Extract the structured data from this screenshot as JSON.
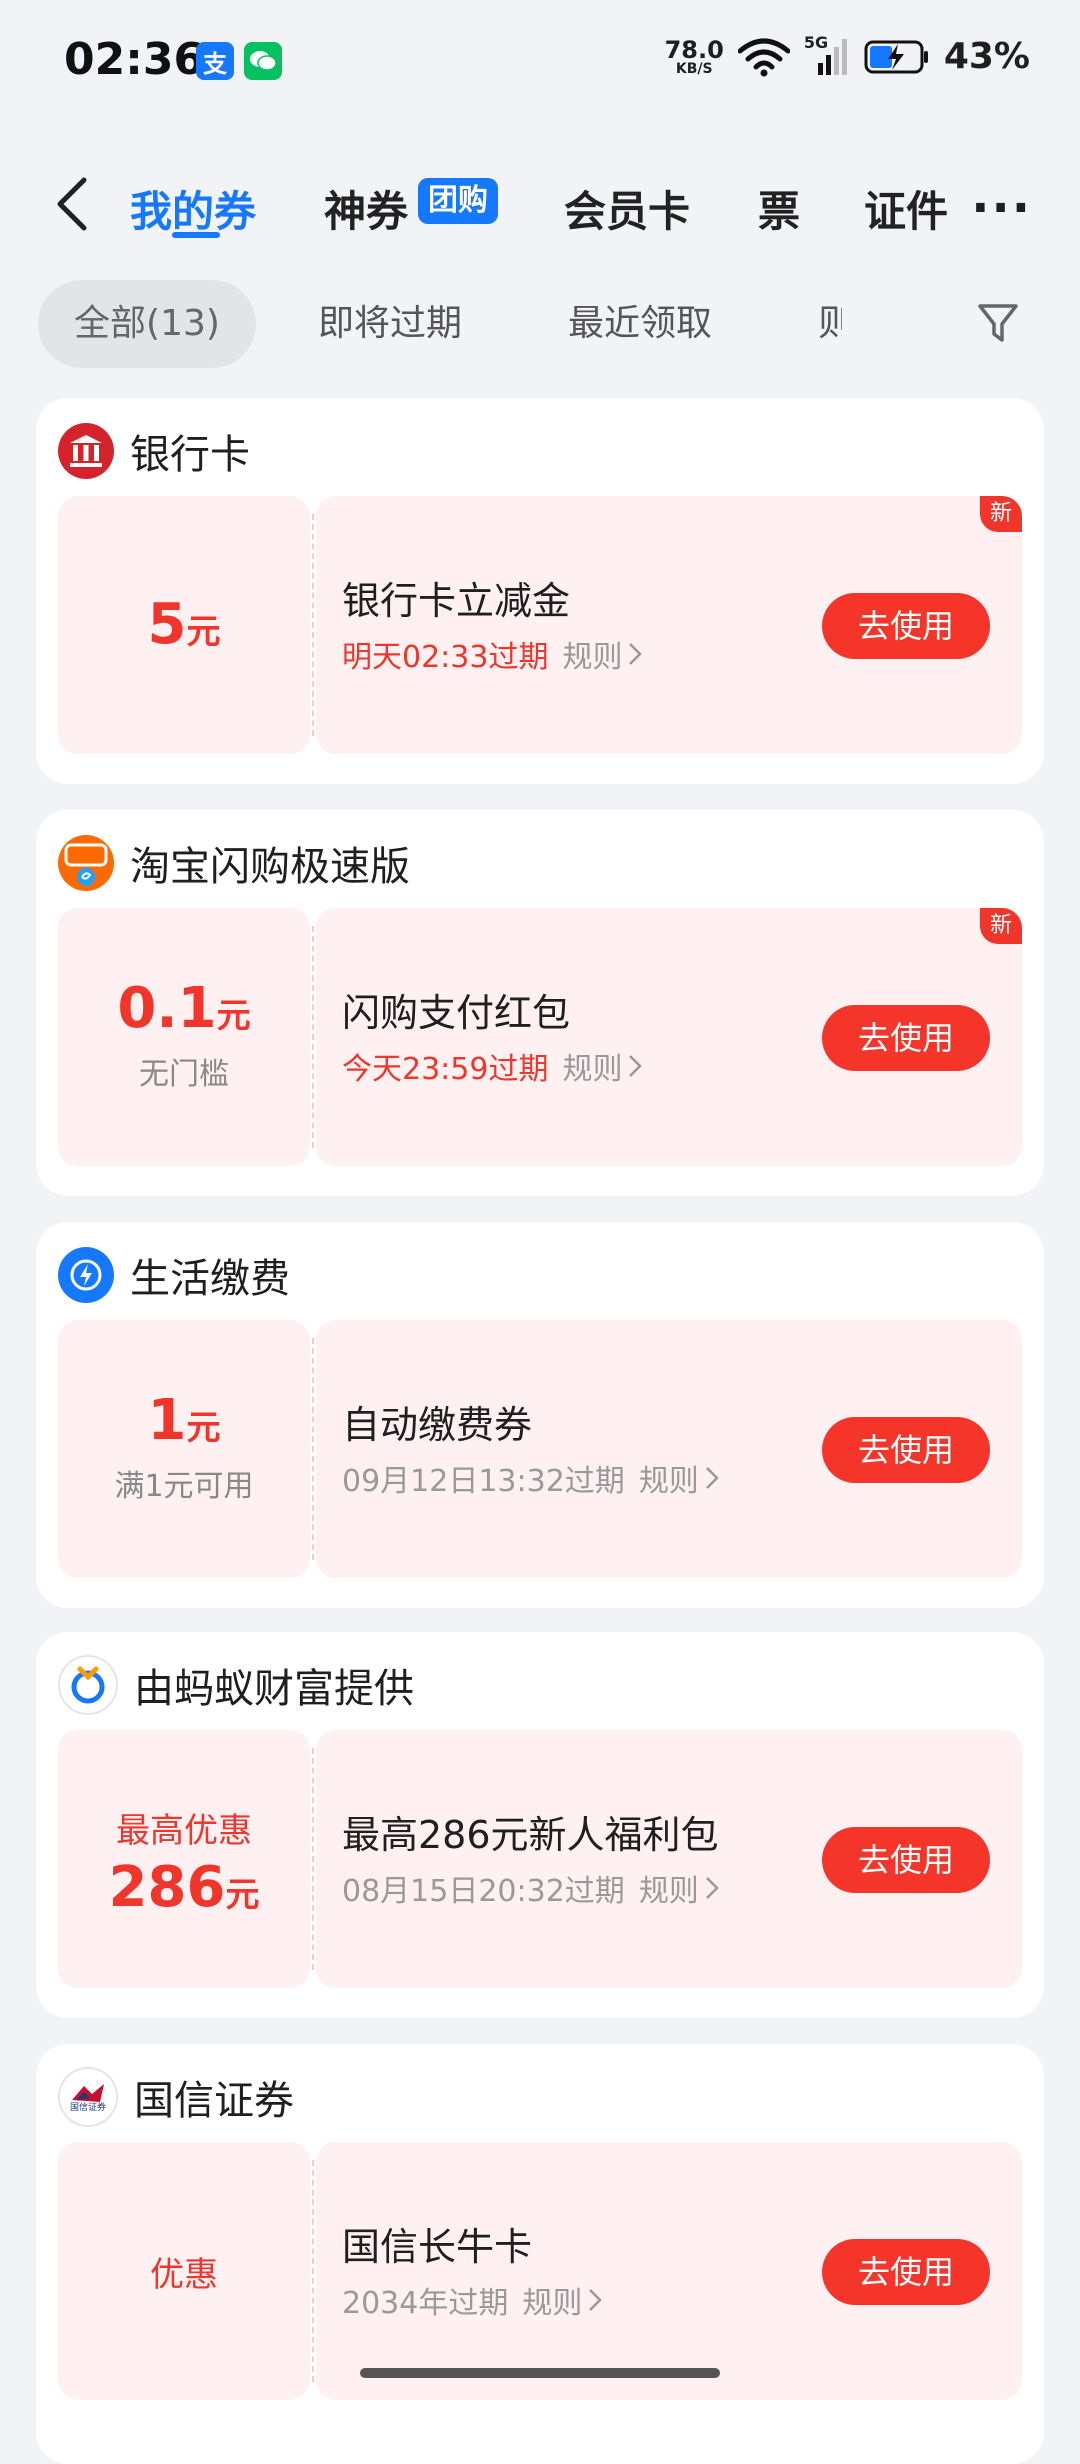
{
  "status_bar": {
    "time": "02:36",
    "net_speed_value": "78.0",
    "net_speed_unit": "KB/S",
    "network_type": "5G",
    "battery": "43%",
    "app_icons": [
      "alipay-icon",
      "wechat-icon"
    ]
  },
  "nav": {
    "tabs": [
      "我的券",
      "神券",
      "会员卡",
      "票",
      "证件"
    ],
    "badge": "团购",
    "more": "···"
  },
  "filters": {
    "chips": [
      "全部(13)",
      "即将过期",
      "最近领取",
      "则"
    ]
  },
  "colors": {
    "accent_blue": "#1677ff",
    "coupon_red": "#f0362b",
    "button_red": "#f5342a",
    "coupon_bg": "#fff0f2"
  },
  "cards": [
    {
      "provider": "银行卡",
      "logo": "bank-card-icon",
      "amount_num": "5",
      "amount_unit": "元",
      "condition": "",
      "name": "银行卡立减金",
      "expiry": "明天02:33过期",
      "expiry_red": true,
      "rule": "规则",
      "button": "去使用",
      "tag": "新"
    },
    {
      "provider": "淘宝闪购极速版",
      "logo": "taobao-flash-icon",
      "amount_num": "0.1",
      "amount_unit": "元",
      "condition": "无门槛",
      "name": "闪购支付红包",
      "expiry": "今天23:59过期",
      "expiry_red": true,
      "rule": "规则",
      "button": "去使用",
      "tag": "新"
    },
    {
      "provider": "生活缴费",
      "logo": "utility-bolt-icon",
      "amount_num": "1",
      "amount_unit": "元",
      "condition": "满1元可用",
      "name": "自动缴费券",
      "expiry": "09月12日13:32过期",
      "expiry_red": false,
      "rule": "规则",
      "button": "去使用",
      "tag": ""
    },
    {
      "provider": "由蚂蚁财富提供",
      "logo": "ant-fortune-icon",
      "amount_prefix": "最高优惠",
      "amount_num": "286",
      "amount_unit": "元",
      "condition": "",
      "name": "最高286元新人福利包",
      "expiry": "08月15日20:32过期",
      "expiry_red": false,
      "rule": "规则",
      "button": "去使用",
      "tag": ""
    },
    {
      "provider": "国信证券",
      "logo": "guosen-securities-icon",
      "logo_text": "国信证券",
      "amount_text": "优惠",
      "name": "国信长牛卡",
      "expiry": "2034年过期",
      "expiry_red": false,
      "rule": "规则",
      "button": "去使用",
      "tag": ""
    }
  ]
}
